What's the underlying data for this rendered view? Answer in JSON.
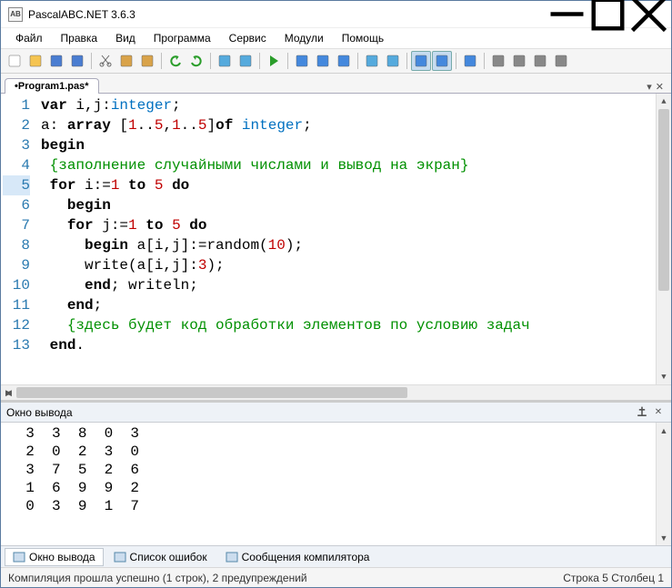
{
  "window": {
    "title": "PascalABC.NET 3.6.3",
    "app_icon_text": "AB"
  },
  "menu": {
    "items": [
      "Файл",
      "Правка",
      "Вид",
      "Программа",
      "Сервис",
      "Модули",
      "Помощь"
    ]
  },
  "toolbar": {
    "buttons": [
      {
        "name": "new-file-icon"
      },
      {
        "name": "open-file-icon"
      },
      {
        "name": "save-icon"
      },
      {
        "name": "save-all-icon"
      },
      {
        "sep": true
      },
      {
        "name": "cut-icon"
      },
      {
        "name": "copy-icon"
      },
      {
        "name": "paste-icon"
      },
      {
        "sep": true
      },
      {
        "name": "undo-icon"
      },
      {
        "name": "redo-icon"
      },
      {
        "sep": true
      },
      {
        "name": "navigate-back-icon"
      },
      {
        "name": "navigate-forward-icon"
      },
      {
        "sep": true
      },
      {
        "name": "run-icon"
      },
      {
        "sep": true
      },
      {
        "name": "step-over-icon"
      },
      {
        "name": "step-into-icon"
      },
      {
        "name": "stop-icon"
      },
      {
        "sep": true
      },
      {
        "name": "insert-template-icon"
      },
      {
        "name": "format-icon"
      },
      {
        "sep": true
      },
      {
        "name": "panel1-icon",
        "active": true
      },
      {
        "name": "panel2-icon",
        "active": true
      },
      {
        "sep": true
      },
      {
        "name": "panel3-icon"
      },
      {
        "sep": true
      },
      {
        "name": "help1-icon"
      },
      {
        "name": "help2-icon"
      },
      {
        "name": "help3-icon"
      },
      {
        "name": "help4-icon"
      }
    ]
  },
  "tabs": {
    "active": "•Program1.pas*"
  },
  "editor": {
    "lines": [
      {
        "n": 1,
        "tokens": [
          {
            "t": "var",
            "c": "kw"
          },
          {
            "t": " i,j:",
            "c": ""
          },
          {
            "t": "integer",
            "c": "type"
          },
          {
            "t": ";",
            "c": ""
          }
        ]
      },
      {
        "n": 2,
        "tokens": [
          {
            "t": "a: ",
            "c": ""
          },
          {
            "t": "array",
            "c": "kw"
          },
          {
            "t": " [",
            "c": ""
          },
          {
            "t": "1",
            "c": "num"
          },
          {
            "t": "..",
            "c": ""
          },
          {
            "t": "5",
            "c": "num"
          },
          {
            "t": ",",
            "c": ""
          },
          {
            "t": "1",
            "c": "num"
          },
          {
            "t": "..",
            "c": ""
          },
          {
            "t": "5",
            "c": "num"
          },
          {
            "t": "]",
            "c": ""
          },
          {
            "t": "of",
            "c": "kw"
          },
          {
            "t": " ",
            "c": ""
          },
          {
            "t": "integer",
            "c": "type"
          },
          {
            "t": ";",
            "c": ""
          }
        ]
      },
      {
        "n": 3,
        "tokens": [
          {
            "t": "begin",
            "c": "kw"
          }
        ]
      },
      {
        "n": 4,
        "tokens": [
          {
            "t": " ",
            "c": ""
          },
          {
            "t": "{заполнение случайными числами и вывод на экран}",
            "c": "cmt"
          }
        ]
      },
      {
        "n": 5,
        "current": true,
        "tokens": [
          {
            "t": " ",
            "c": ""
          },
          {
            "t": "for",
            "c": "kw"
          },
          {
            "t": " i:=",
            "c": ""
          },
          {
            "t": "1",
            "c": "num"
          },
          {
            "t": " ",
            "c": ""
          },
          {
            "t": "to",
            "c": "kw"
          },
          {
            "t": " ",
            "c": ""
          },
          {
            "t": "5",
            "c": "num"
          },
          {
            "t": " ",
            "c": ""
          },
          {
            "t": "do",
            "c": "kw"
          }
        ]
      },
      {
        "n": 6,
        "tokens": [
          {
            "t": "   ",
            "c": ""
          },
          {
            "t": "begin",
            "c": "kw"
          }
        ]
      },
      {
        "n": 7,
        "tokens": [
          {
            "t": "   ",
            "c": ""
          },
          {
            "t": "for",
            "c": "kw"
          },
          {
            "t": " j:=",
            "c": ""
          },
          {
            "t": "1",
            "c": "num"
          },
          {
            "t": " ",
            "c": ""
          },
          {
            "t": "to",
            "c": "kw"
          },
          {
            "t": " ",
            "c": ""
          },
          {
            "t": "5",
            "c": "num"
          },
          {
            "t": " ",
            "c": ""
          },
          {
            "t": "do",
            "c": "kw"
          }
        ]
      },
      {
        "n": 8,
        "tokens": [
          {
            "t": "     ",
            "c": ""
          },
          {
            "t": "begin",
            "c": "kw"
          },
          {
            "t": " a[i,j]:=random(",
            "c": ""
          },
          {
            "t": "10",
            "c": "num"
          },
          {
            "t": ");",
            "c": ""
          }
        ]
      },
      {
        "n": 9,
        "tokens": [
          {
            "t": "     write(a[i,j]:",
            "c": ""
          },
          {
            "t": "3",
            "c": "num"
          },
          {
            "t": ");",
            "c": ""
          }
        ]
      },
      {
        "n": 10,
        "tokens": [
          {
            "t": "     ",
            "c": ""
          },
          {
            "t": "end",
            "c": "kw"
          },
          {
            "t": "; writeln;",
            "c": ""
          }
        ]
      },
      {
        "n": 11,
        "tokens": [
          {
            "t": "   ",
            "c": ""
          },
          {
            "t": "end",
            "c": "kw"
          },
          {
            "t": ";",
            "c": ""
          }
        ]
      },
      {
        "n": 12,
        "tokens": [
          {
            "t": "   ",
            "c": ""
          },
          {
            "t": "{здесь будет код обработки элементов по условию задач",
            "c": "cmt"
          }
        ]
      },
      {
        "n": 13,
        "tokens": [
          {
            "t": " ",
            "c": ""
          },
          {
            "t": "end",
            "c": "kw"
          },
          {
            "t": ".",
            "c": ""
          }
        ]
      }
    ]
  },
  "output": {
    "title": "Окно вывода",
    "rows": [
      [
        3,
        3,
        8,
        0,
        3
      ],
      [
        2,
        0,
        2,
        3,
        0
      ],
      [
        3,
        7,
        5,
        2,
        6
      ],
      [
        1,
        6,
        9,
        9,
        2
      ],
      [
        0,
        3,
        9,
        1,
        7
      ]
    ]
  },
  "bottom_tabs": {
    "items": [
      {
        "label": "Окно вывода",
        "active": true
      },
      {
        "label": "Список ошибок",
        "active": false
      },
      {
        "label": "Сообщения компилятора",
        "active": false
      }
    ]
  },
  "status": {
    "left": "Компиляция прошла успешно (1 строк), 2 предупреждений",
    "right": "Строка  5 Столбец  1"
  }
}
